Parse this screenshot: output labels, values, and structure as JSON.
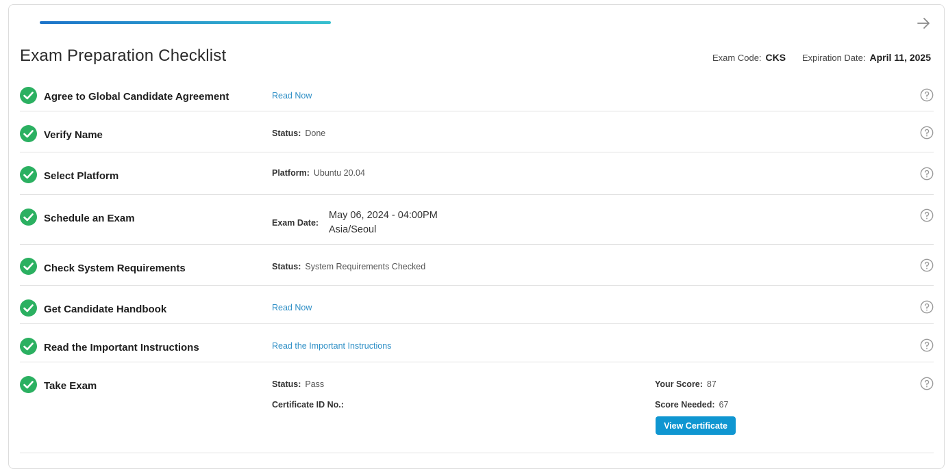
{
  "header": {
    "progress_percent": 100,
    "title": "Exam Preparation Checklist",
    "exam_code_label": "Exam Code:",
    "exam_code": "CKS",
    "expiration_label": "Expiration Date:",
    "expiration_date": "April 11, 2025"
  },
  "rows": [
    {
      "title": "Agree to Global Candidate Agreement",
      "link": "Read Now"
    },
    {
      "title": "Verify Name",
      "label": "Status:",
      "value": "Done"
    },
    {
      "title": "Select Platform",
      "label": "Platform:",
      "value": "Ubuntu 20.04"
    },
    {
      "title": "Schedule an Exam",
      "label": "Exam Date:",
      "value": "May 06, 2024 - 04:00PM",
      "value2": "Asia/Seoul"
    },
    {
      "title": "Check System Requirements",
      "label": "Status:",
      "value": "System Requirements Checked"
    },
    {
      "title": "Get Candidate Handbook",
      "link": "Read Now"
    },
    {
      "title": "Read the Important Instructions",
      "link": "Read the Important Instructions"
    },
    {
      "title": "Take Exam",
      "label": "Status:",
      "value": "Pass",
      "cert_label": "Certificate ID No.:",
      "score_label": "Your Score:",
      "score": "87",
      "needed_label": "Score Needed:",
      "needed": "67",
      "button": "View Certificate"
    }
  ],
  "colors": {
    "check": "#2bb061",
    "link": "#2e8fc6",
    "button": "#0f96d1"
  },
  "icons": {
    "complete": "check-circle-icon",
    "help": "question-circle-icon",
    "next": "arrow-right-icon"
  }
}
